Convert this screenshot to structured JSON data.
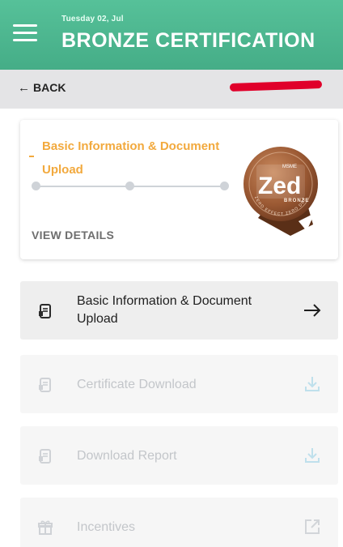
{
  "header": {
    "date": "Tuesday 02, Jul",
    "title": "BRONZE CERTIFICATION"
  },
  "backbar": {
    "back_label": "BACK"
  },
  "status_card": {
    "step_title": "Basic Information & Document Upload",
    "view_details": "VIEW DETAILS",
    "progress_steps": 3,
    "badge": {
      "small_text": "MSME",
      "logo_text": "Zed",
      "level_text": "BRONZE",
      "ring_text": "ZERO EFFECT ZERO DEFECT"
    }
  },
  "menu": {
    "items": [
      {
        "label": "Basic Information & Document Upload",
        "icon": "document-icon",
        "action_icon": "arrow-right-icon",
        "enabled": true
      },
      {
        "label": "Certificate Download",
        "icon": "document-icon",
        "action_icon": "download-icon",
        "enabled": false
      },
      {
        "label": "Download Report",
        "icon": "document-icon",
        "action_icon": "download-icon",
        "enabled": false
      },
      {
        "label": "Incentives",
        "icon": "gift-icon",
        "action_icon": "external-link-icon",
        "enabled": false
      }
    ]
  },
  "colors": {
    "header_green": "#4fb790",
    "accent_orange": "#f2a93d",
    "redacted_red": "#e0002a",
    "disabled_text": "#c3c6ca"
  }
}
